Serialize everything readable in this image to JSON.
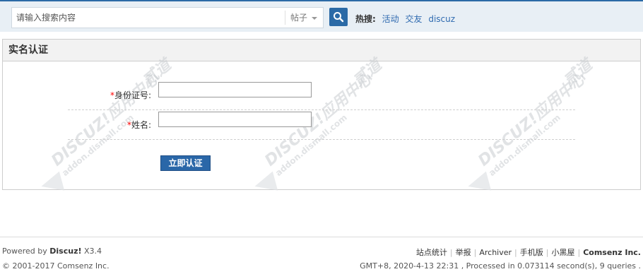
{
  "search": {
    "placeholder": "请输入搜索内容",
    "type_label": "帖子",
    "hot_label": "热搜:",
    "hot_links": [
      "活动",
      "交友",
      "discuz"
    ]
  },
  "panel": {
    "title": "实名认证",
    "fields": [
      {
        "required_mark": "*",
        "label": "身份证号:",
        "value": ""
      },
      {
        "required_mark": "*",
        "label": "姓名:",
        "value": ""
      }
    ],
    "submit_label": "立即认证"
  },
  "watermark": {
    "brand": "DISCUZ!应用中心",
    "suffix": "贰道",
    "url": "addon.dismall.com"
  },
  "footer": {
    "powered_prefix": "Powered by",
    "powered_brand": "Discuz!",
    "powered_version": "X3.4",
    "copyright": "© 2001-2017 Comsenz Inc.",
    "links": [
      "站点统计",
      "举报",
      "Archiver",
      "手机版",
      "小黑屋"
    ],
    "company": "Comsenz Inc.",
    "stats": "GMT+8, 2020-4-13 22:31 , Processed in 0.073114 second(s), 9 queries ."
  },
  "colors": {
    "accent": "#2b6aa6",
    "link": "#2f6ab0",
    "required": "#ff0000"
  }
}
